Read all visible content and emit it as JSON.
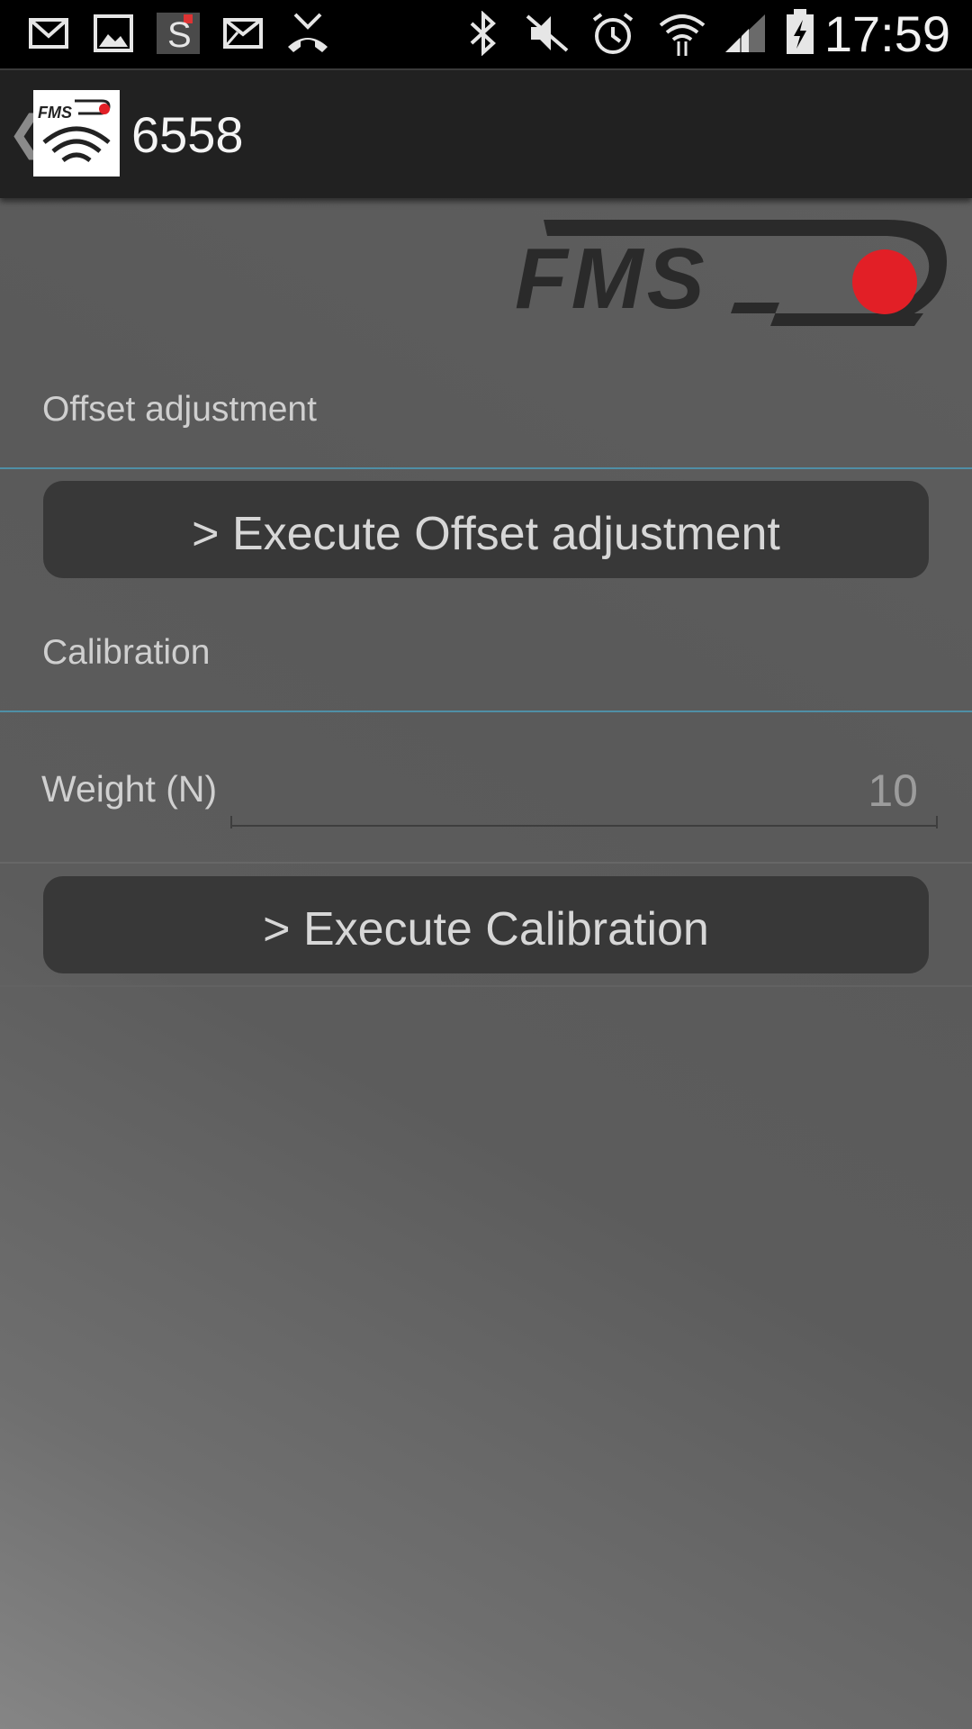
{
  "status_bar": {
    "time": "17:59",
    "icons": [
      "gmail-icon",
      "gallery-icon",
      "s-app-icon",
      "email-icon",
      "missed-call-icon",
      "bluetooth-icon",
      "mute-icon",
      "alarm-icon",
      "wifi-icon",
      "signal-icon",
      "battery-charging-icon"
    ]
  },
  "action_bar": {
    "title": "6558",
    "app_icon_text": "FMS"
  },
  "brand": {
    "logo_text": "FMS",
    "accent_color": "#e21f26"
  },
  "offset": {
    "section_label": "Offset adjustment",
    "button_label": "> Execute Offset adjustment"
  },
  "calibration": {
    "section_label": "Calibration",
    "weight_label": "Weight (N)",
    "weight_value": "10",
    "button_label": "> Execute Calibration"
  }
}
